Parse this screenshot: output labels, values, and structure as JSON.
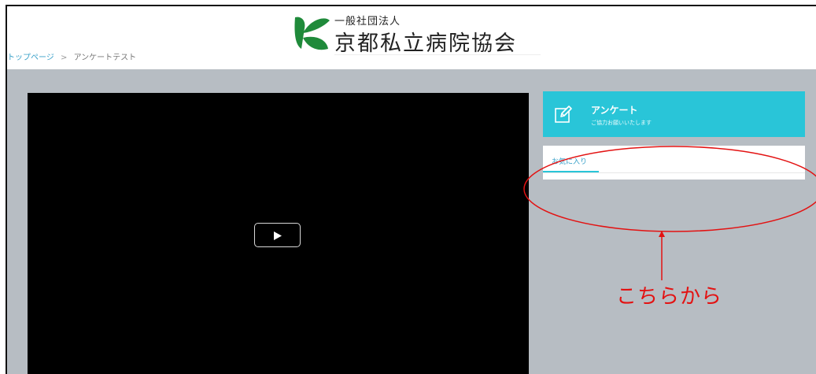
{
  "header": {
    "org_small": "一般社団法人",
    "org_name": "京都私立病院協会",
    "brand_color": "#1f8a3a"
  },
  "breadcrumb": {
    "home": "トップページ",
    "separator": ">",
    "current": "アンケートテスト"
  },
  "video": {
    "icon": "play-icon"
  },
  "survey": {
    "title": "アンケート",
    "subtitle": "ご協力お願いいたします",
    "icon": "pencil-square-icon",
    "color": "#29c5d8"
  },
  "favorites": {
    "tab_label": "お気に入り"
  },
  "annotation": {
    "text": "こちらから",
    "color": "#e31212"
  }
}
